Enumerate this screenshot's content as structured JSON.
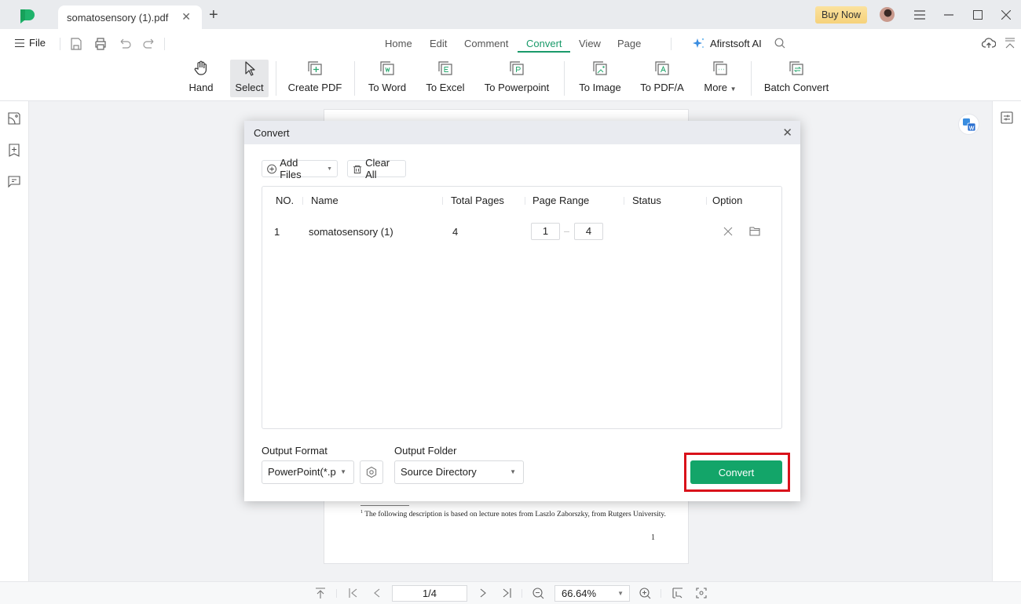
{
  "titlebar": {
    "app_logo": "afirstsoft-pdf-logo",
    "tab_title": "somatosensory (1).pdf",
    "buy_now": "Buy Now"
  },
  "menubar": {
    "file": "File",
    "tabs": [
      "Home",
      "Edit",
      "Comment",
      "Convert",
      "View",
      "Page"
    ],
    "active_tab": "Convert",
    "ai_label": "Afirstsoft AI"
  },
  "ribbon": {
    "items": [
      {
        "label": "Hand",
        "icon": "hand-icon"
      },
      {
        "label": "Select",
        "icon": "cursor-icon"
      },
      {
        "label": "Create PDF",
        "icon": "create-pdf-icon"
      },
      {
        "label": "To Word",
        "icon": "to-word-icon"
      },
      {
        "label": "To Excel",
        "icon": "to-excel-icon"
      },
      {
        "label": "To Powerpoint",
        "icon": "to-powerpoint-icon"
      },
      {
        "label": "To Image",
        "icon": "to-image-icon"
      },
      {
        "label": "To PDF/A",
        "icon": "to-pdfa-icon"
      },
      {
        "label": "More",
        "icon": "more-icon"
      },
      {
        "label": "Batch Convert",
        "icon": "batch-convert-icon"
      }
    ]
  },
  "document": {
    "footnote_marker": "1",
    "footnote": "The following description is based on lecture notes from Laszlo Zaborszky, from Rutgers University.",
    "page_number": "1"
  },
  "statusbar": {
    "page": "1/4",
    "zoom": "66.64%"
  },
  "dialog": {
    "title": "Convert",
    "add_files": "Add Files",
    "clear_all": "Clear All",
    "columns": [
      "NO.",
      "Name",
      "Total Pages",
      "Page Range",
      "Status",
      "Option"
    ],
    "rows": [
      {
        "no": "1",
        "name": "somatosensory (1)",
        "total_pages": "4",
        "range_from": "1",
        "range_to": "4",
        "status": ""
      }
    ],
    "output_format_label": "Output Format",
    "output_format_value": "PowerPoint(*.p",
    "output_folder_label": "Output Folder",
    "output_folder_value": "Source Directory",
    "convert_button": "Convert"
  },
  "colors": {
    "accent_green": "#13a569",
    "tab_active": "#1a9a6a",
    "highlight_red": "#d9121b",
    "buy_now": "#f6d27b"
  }
}
